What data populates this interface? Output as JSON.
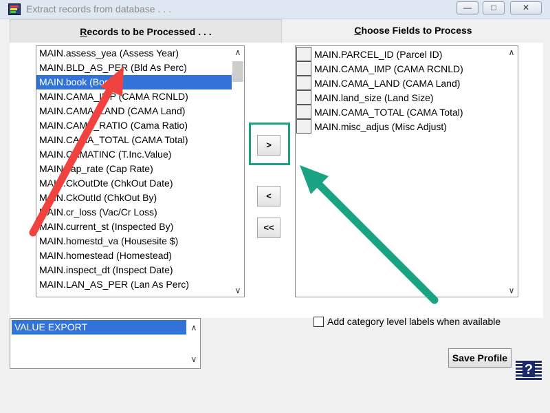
{
  "window": {
    "title": "Extract records from database . . .",
    "minimize": "—",
    "maximize": "□",
    "close": "✕"
  },
  "tabs": {
    "records": {
      "accel": "R",
      "rest": "ecords to be Processed . . ."
    },
    "fields": {
      "accel": "C",
      "rest": "hoose Fields to Process"
    }
  },
  "records_list": {
    "items": [
      "MAIN.assess_yea (Assess Year)",
      "MAIN.BLD_AS_PER (Bld As Perc)",
      "MAIN.book (Book)",
      "MAIN.CAMA_IMP (CAMA RCNLD)",
      "MAIN.CAMA_LAND (CAMA Land)",
      "MAIN.CAMA_RATIO (Cama Ratio)",
      "MAIN.CAMA_TOTAL (CAMA Total)",
      "MAIN.CAMATINC (T.Inc.Value)",
      "MAIN.cap_rate (Cap Rate)",
      "MAIN.CkOutDte (ChkOut Date)",
      "MAIN.CkOutId (ChkOut By)",
      "MAIN.cr_loss (Vac/Cr Loss)",
      "MAIN.current_st (Inspected By)",
      "MAIN.homestd_va (Housesite $)",
      "MAIN.homestead (Homestead)",
      "MAIN.inspect_dt (Inspect Date)",
      "MAIN.LAN_AS_PER (Lan As Perc)"
    ],
    "selected_index": 2,
    "scroll_up": "∧",
    "scroll_down": "∨"
  },
  "fields_list": {
    "items": [
      "MAIN.PARCEL_ID (Parcel ID)",
      "MAIN.CAMA_IMP (CAMA RCNLD)",
      "MAIN.CAMA_LAND (CAMA Land)",
      "MAIN.land_size (Land Size)",
      "MAIN.CAMA_TOTAL (CAMA Total)",
      "MAIN.misc_adjus (Misc Adjust)"
    ],
    "scroll_up": "∧",
    "scroll_down": "∨"
  },
  "move_buttons": {
    "add": ">",
    "remove": "<",
    "remove_all": "<<"
  },
  "profiles": {
    "items": [
      "VALUE EXPORT"
    ],
    "scroll_up": "∧",
    "scroll_down": "∨"
  },
  "options": {
    "category_labels": "Add category level labels when available"
  },
  "actions": {
    "save_profile": "Save Profile",
    "help": "?"
  },
  "colors": {
    "selection": "#3173d8",
    "red_arrow": "#f0433f",
    "green_arrow": "#19a383",
    "highlight_box": "#19a383"
  }
}
